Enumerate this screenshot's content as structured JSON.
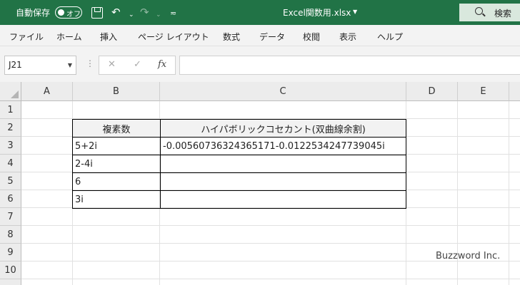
{
  "titlebar": {
    "autosave_label": "自動保存",
    "autosave_state": "オフ",
    "filename": "Excel関数用.xlsx",
    "search_label": "検索",
    "undo_icon": "undo-icon",
    "redo_icon": "redo-icon"
  },
  "menu": [
    {
      "label": "ファイル"
    },
    {
      "label": "ホーム"
    },
    {
      "label": "挿入"
    },
    {
      "label": "ページ レイアウト"
    },
    {
      "label": "数式"
    },
    {
      "label": "データ"
    },
    {
      "label": "校閲"
    },
    {
      "label": "表示"
    },
    {
      "label": "ヘルプ"
    }
  ],
  "formula_bar": {
    "name_box": "J21",
    "cancel": "✕",
    "enter": "✓",
    "fx": "fx",
    "formula": ""
  },
  "sheet": {
    "columns": [
      "A",
      "B",
      "C",
      "D",
      "E"
    ],
    "rows": [
      "1",
      "2",
      "3",
      "4",
      "5",
      "6",
      "7",
      "8",
      "9",
      "10"
    ],
    "table_header": [
      "複素数",
      "ハイパボリックコセカント(双曲線余割)"
    ],
    "table_rows": [
      [
        "5+2i",
        "-0.00560736324365171-0.0122534247739045i"
      ],
      [
        "2-4i",
        ""
      ],
      [
        "6",
        ""
      ],
      [
        "3i",
        ""
      ]
    ]
  },
  "watermark": "Buzzword Inc.",
  "colors": {
    "accent": "#217346"
  }
}
